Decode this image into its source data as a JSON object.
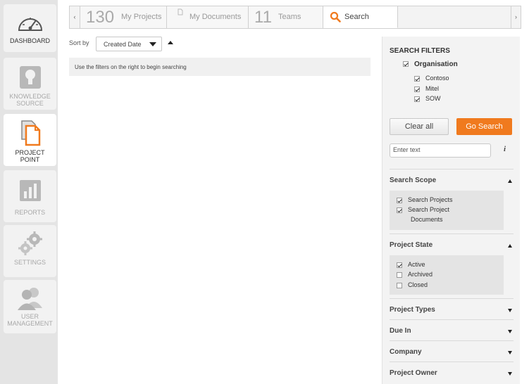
{
  "sidebar": {
    "items": [
      {
        "label": "DASHBOARD",
        "icon": "gauge-icon"
      },
      {
        "label": "KNOWLEDGE SOURCE",
        "icon": "lightbulb-icon"
      },
      {
        "label": "PROJECT POINT",
        "icon": "documents-icon"
      },
      {
        "label": "REPORTS",
        "icon": "bar-chart-icon"
      },
      {
        "label": "SETTINGS",
        "icon": "gears-icon"
      },
      {
        "label": "USER MANAGEMENT",
        "icon": "users-icon"
      }
    ]
  },
  "tabs": {
    "prev": "‹",
    "next": "›",
    "my_projects": {
      "count": "130",
      "label": "My Projects"
    },
    "my_documents": {
      "label": "My Documents"
    },
    "teams": {
      "count": "11",
      "label": "Teams"
    },
    "search": {
      "label": "Search"
    }
  },
  "sort": {
    "label": "Sort by",
    "value": "Created Date"
  },
  "hint": "Use the filters on the right to begin searching",
  "filters": {
    "title": "SEARCH FILTERS",
    "organisation": {
      "label": "Organisation",
      "checked": true,
      "items": [
        {
          "label": "Contoso",
          "checked": true
        },
        {
          "label": "Mitel",
          "checked": true
        },
        {
          "label": "SOW",
          "checked": true
        }
      ]
    },
    "clear_label": "Clear all",
    "go_label": "Go Search",
    "text_placeholder": "Enter text",
    "info_label": "i",
    "search_scope": {
      "title": "Search Scope",
      "items": [
        {
          "label": "Search Projects",
          "checked": true
        },
        {
          "label": "Search Project",
          "label2": "Documents",
          "checked": true
        }
      ]
    },
    "project_state": {
      "title": "Project State",
      "items": [
        {
          "label": "Active",
          "checked": true
        },
        {
          "label": "Archived",
          "checked": false
        },
        {
          "label": "Closed",
          "checked": false
        }
      ]
    },
    "collapsed": [
      {
        "title": "Project Types"
      },
      {
        "title": "Due In"
      },
      {
        "title": "Company"
      },
      {
        "title": "Project Owner"
      }
    ]
  },
  "colors": {
    "accent": "#f07a1e",
    "sidebar_bg": "#e4e4e4",
    "panel_bg": "#f3f3f3"
  }
}
